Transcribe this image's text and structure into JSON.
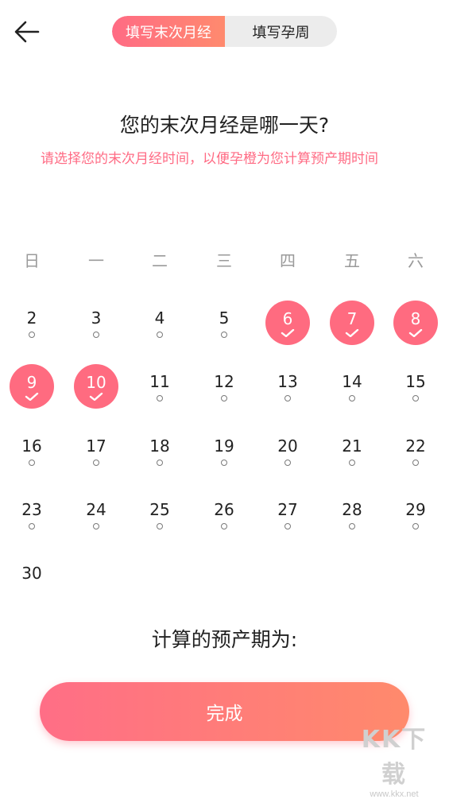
{
  "header": {
    "back_icon": "arrow-left-icon",
    "tabs": [
      {
        "label": "填写末次月经",
        "active": true
      },
      {
        "label": "填写孕周",
        "active": false
      }
    ]
  },
  "question": {
    "title": "您的末次月经是哪一天?",
    "hint": "请选择您的末次月经时间，以便孕橙为您计算预产期时间"
  },
  "calendar": {
    "weekdays": [
      "日",
      "一",
      "二",
      "三",
      "四",
      "五",
      "六"
    ],
    "days": [
      {
        "day": "2",
        "selected": false
      },
      {
        "day": "3",
        "selected": false
      },
      {
        "day": "4",
        "selected": false
      },
      {
        "day": "5",
        "selected": false
      },
      {
        "day": "6",
        "selected": true
      },
      {
        "day": "7",
        "selected": true
      },
      {
        "day": "8",
        "selected": true
      },
      {
        "day": "9",
        "selected": true
      },
      {
        "day": "10",
        "selected": true
      },
      {
        "day": "11",
        "selected": false
      },
      {
        "day": "12",
        "selected": false
      },
      {
        "day": "13",
        "selected": false
      },
      {
        "day": "14",
        "selected": false
      },
      {
        "day": "15",
        "selected": false
      },
      {
        "day": "16",
        "selected": false
      },
      {
        "day": "17",
        "selected": false
      },
      {
        "day": "18",
        "selected": false
      },
      {
        "day": "19",
        "selected": false
      },
      {
        "day": "20",
        "selected": false
      },
      {
        "day": "21",
        "selected": false
      },
      {
        "day": "22",
        "selected": false
      },
      {
        "day": "23",
        "selected": false
      },
      {
        "day": "24",
        "selected": false
      },
      {
        "day": "25",
        "selected": false
      },
      {
        "day": "26",
        "selected": false
      },
      {
        "day": "27",
        "selected": false
      },
      {
        "day": "28",
        "selected": false
      },
      {
        "day": "29",
        "selected": false
      },
      {
        "day": "30",
        "selected": false,
        "no_dot": true
      }
    ]
  },
  "result": {
    "label": "计算的预产期为:"
  },
  "button": {
    "label": "完成"
  },
  "watermark": {
    "brand": "KK下载",
    "url": "www.kkx.net"
  },
  "colors": {
    "accent": "#ff6b84",
    "accent_end": "#ff8a6e"
  }
}
